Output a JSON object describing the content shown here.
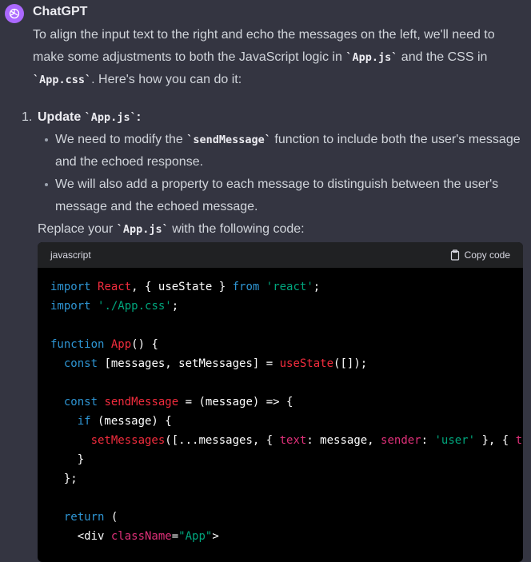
{
  "message": {
    "author": "ChatGPT",
    "intro": [
      "To align the input text to the right and echo the messages on the left, we'll need to make some adjustments to both the JavaScript logic in ",
      "`App.js`",
      " and the CSS in ",
      "`App.css`",
      ". Here's how you can do it:"
    ],
    "list_number": "1.",
    "step_title_prefix": "Update ",
    "step_title_code": "`App.js`",
    "step_title_suffix": ":",
    "bullets": [
      {
        "pre": "We need to modify the ",
        "code": "`sendMessage`",
        "post": " function to include both the user's message and the echoed response."
      },
      {
        "pre": "We will also add a property to each message to distinguish between the user's message and the echoed message.",
        "code": "",
        "post": ""
      }
    ],
    "replace_pre": "Replace your ",
    "replace_code": "`App.js`",
    "replace_post": " with the following code:"
  },
  "code_block": {
    "language": "javascript",
    "copy_label": "Copy code",
    "lines": [
      [
        [
          "import",
          "k"
        ],
        [
          " ",
          "p0"
        ],
        [
          "React",
          "f"
        ],
        [
          ", { useState } ",
          "p0"
        ],
        [
          "from",
          "k"
        ],
        [
          " ",
          "p0"
        ],
        [
          "'react'",
          "s"
        ],
        [
          ";",
          "p0"
        ]
      ],
      [
        [
          "import",
          "k"
        ],
        [
          " ",
          "p0"
        ],
        [
          "'./App.css'",
          "s"
        ],
        [
          ";",
          "p0"
        ]
      ],
      [],
      [
        [
          "function",
          "k"
        ],
        [
          " ",
          "p0"
        ],
        [
          "App",
          "f"
        ],
        [
          "() {",
          "p0"
        ]
      ],
      [
        [
          "  ",
          "p0"
        ],
        [
          "const",
          "k"
        ],
        [
          " [messages, setMessages] = ",
          "p0"
        ],
        [
          "useState",
          "f"
        ],
        [
          "([]);",
          "p0"
        ]
      ],
      [],
      [
        [
          "  ",
          "p0"
        ],
        [
          "const",
          "k"
        ],
        [
          " ",
          "p0"
        ],
        [
          "sendMessage",
          "f"
        ],
        [
          " = (message) => {",
          "p0"
        ]
      ],
      [
        [
          "    ",
          "p0"
        ],
        [
          "if",
          "k"
        ],
        [
          " (message) {",
          "p0"
        ]
      ],
      [
        [
          "      ",
          "p0"
        ],
        [
          "setMessages",
          "f"
        ],
        [
          "([...messages, { ",
          "p0"
        ],
        [
          "text",
          "a"
        ],
        [
          ": message, ",
          "p0"
        ],
        [
          "sender",
          "a"
        ],
        [
          ": ",
          "p0"
        ],
        [
          "'user'",
          "s"
        ],
        [
          " }, { ",
          "p0"
        ],
        [
          "text",
          "a"
        ]
      ],
      [
        [
          "    }",
          "p0"
        ]
      ],
      [
        [
          "  };",
          "p0"
        ]
      ],
      [],
      [
        [
          "  ",
          "p0"
        ],
        [
          "return",
          "k"
        ],
        [
          " (",
          "p0"
        ]
      ],
      [
        [
          "    <div ",
          "p0"
        ],
        [
          "className",
          "a"
        ],
        [
          "=",
          "p0"
        ],
        [
          "\"App\"",
          "s"
        ],
        [
          ">",
          "p0"
        ]
      ]
    ]
  }
}
